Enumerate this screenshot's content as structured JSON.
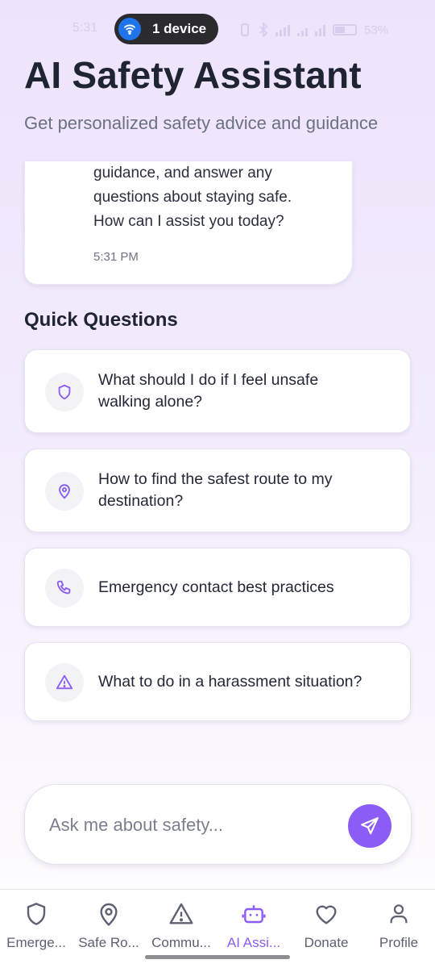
{
  "status_bar": {
    "time": "5:31",
    "device_pill_label": "1 device",
    "battery_percent": "53%",
    "icons": [
      "wifi-hotspot-icon",
      "vibrate-icon",
      "bluetooth-icon",
      "signal-icon",
      "wifi-icon",
      "battery-icon"
    ]
  },
  "header": {
    "title": "AI Safety Assistant",
    "subtitle": "Get personalized safety advice and guidance"
  },
  "chat": {
    "message_lines": [
      "guidance, and answer any",
      "questions about staying safe.",
      "How can I assist you today?"
    ],
    "timestamp": "5:31 PM"
  },
  "quick_questions": {
    "title": "Quick Questions",
    "items": [
      {
        "icon": "shield-icon",
        "line1": "What should I do if I feel unsafe",
        "line2": "walking alone?"
      },
      {
        "icon": "location-pin-icon",
        "line1": "How to find the safest route to my",
        "line2": "destination?"
      },
      {
        "icon": "phone-icon",
        "line1": "Emergency contact best practices",
        "line2": ""
      },
      {
        "icon": "warning-icon",
        "line1": "What to do in a harassment situation?",
        "line2": ""
      }
    ]
  },
  "ask": {
    "placeholder": "Ask me about safety...",
    "value": "",
    "send_icon": "send-icon"
  },
  "bottom_nav": {
    "items": [
      {
        "label": "Emerge...",
        "icon": "shield-icon",
        "active": false
      },
      {
        "label": "Safe Ro...",
        "icon": "location-pin-icon",
        "active": false
      },
      {
        "label": "Commu...",
        "icon": "warning-icon",
        "active": false
      },
      {
        "label": "AI Assi...",
        "icon": "robot-icon",
        "active": true
      },
      {
        "label": "Donate",
        "icon": "heart-icon",
        "active": false
      },
      {
        "label": "Profile",
        "icon": "user-icon",
        "active": false
      }
    ]
  },
  "colors": {
    "accent": "#8b5cf6",
    "title_text": "#1f2433",
    "subtitle_text": "#6b7083",
    "nav_inactive": "#5d6172"
  }
}
